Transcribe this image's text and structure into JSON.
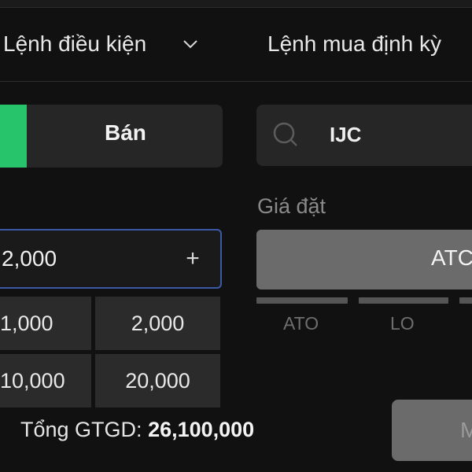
{
  "tabs": {
    "conditional_order": "Lệnh điều kiện",
    "periodic_buy": "Lệnh mua định kỳ"
  },
  "side": {
    "sell_label": "Bán"
  },
  "search": {
    "value": "IJC"
  },
  "quantity": {
    "value": "2,000",
    "plus": "+",
    "quick_options": [
      "1,000",
      "2,000",
      "10,000",
      "20,000"
    ]
  },
  "price": {
    "label": "Giá đặt",
    "selected_type": "ATC",
    "types": [
      "ATO",
      "LO"
    ]
  },
  "summary": {
    "total_label": "Tổng GTGD:",
    "total_value": "26,100,000"
  },
  "submit": {
    "label": "M"
  },
  "colors": {
    "buy_accent": "#27c46b",
    "focus_border": "#3a5aa8"
  },
  "icons": [
    "chevron-down-icon",
    "search-icon"
  ]
}
